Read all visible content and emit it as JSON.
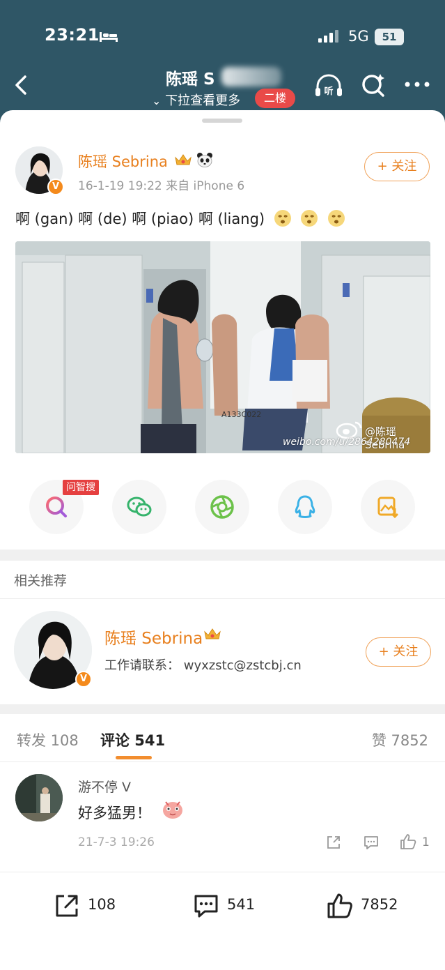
{
  "status_bar": {
    "time": "23:21",
    "network": "5G",
    "battery": "51"
  },
  "nav": {
    "title": "陈瑶 S",
    "pull_hint": "下拉查看更多",
    "floor_badge": "二楼"
  },
  "post": {
    "author": "陈瑶 Sebrina",
    "meta": "16-1-19 19:22  来自 iPhone 6",
    "follow_label": "+ 关注",
    "text": "啊 (gan) 啊 (de) 啊 (piao) 啊 (liang)",
    "image_watermark_name": "@陈瑶Sebrina",
    "image_watermark_url": "weibo.com/u/2864280474",
    "image_sign": "A133C022",
    "verified_mark": "V"
  },
  "share": {
    "zhisou_tag": "问智搜",
    "items": [
      "search-ai-icon",
      "wechat-icon",
      "moments-icon",
      "qq-icon",
      "save-image-icon"
    ]
  },
  "related": {
    "title": "相关推荐",
    "name": "陈瑶 Sebrina",
    "desc": "工作请联系：  wyxzstc@zstcbj.cn",
    "follow_label": "+ 关注",
    "verified_mark": "V"
  },
  "tabs": {
    "repost": "转发 108",
    "comment": "评论 541",
    "like": "赞 7852"
  },
  "comment": {
    "user": "游不停 V",
    "text": "好多猛男！",
    "time": "21-7-3 19:26",
    "likes": "1"
  },
  "bottom_bar": {
    "repost_count": "108",
    "comment_count": "541",
    "like_count": "7852"
  },
  "colors": {
    "accent": "#e8801f",
    "header_bg": "#2f5666",
    "badge_red": "#e94a48"
  }
}
